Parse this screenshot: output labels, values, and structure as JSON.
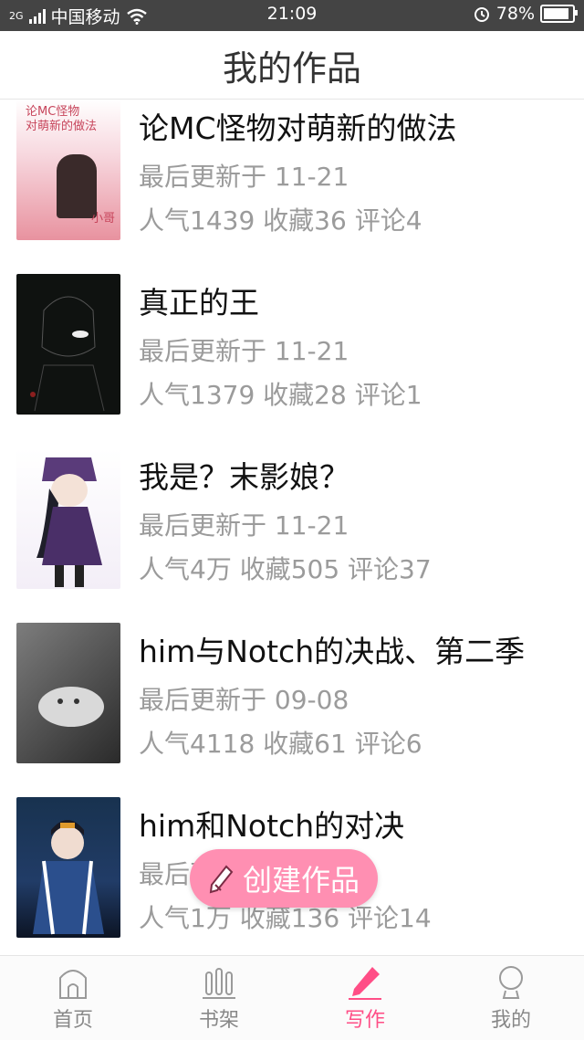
{
  "status_bar": {
    "network_small": "2G",
    "carrier": "中国移动",
    "time": "21:09",
    "battery": "78%"
  },
  "header": {
    "title": "我的作品"
  },
  "works": [
    {
      "title": "论MC怪物对萌新的做法",
      "updated": "最后更新于 11-21",
      "stats": "人气1439 收藏36 评论4",
      "cover_text_1": "论MC怪物",
      "cover_text_2": "对萌新的做法",
      "cover_text_3": "小哥"
    },
    {
      "title": "真正的王",
      "updated": "最后更新于 11-21",
      "stats": "人气1379 收藏28 评论1"
    },
    {
      "title": "我是？末影娘？",
      "updated": "最后更新于 11-21",
      "stats": "人气4万 收藏505 评论37"
    },
    {
      "title": "him与Notch的决战、第二季",
      "updated": "最后更新于 09-08",
      "stats": "人气4118 收藏61 评论6"
    },
    {
      "title": "him和Notch的对决",
      "updated": "最后更新于",
      "stats": "人气1万 收藏136 评论14"
    }
  ],
  "fab": {
    "label": "创建作品",
    "color": "#ff8fb2"
  },
  "bottom_nav": [
    {
      "label": "首页",
      "icon": "home-icon",
      "active": false
    },
    {
      "label": "书架",
      "icon": "bookshelf-icon",
      "active": false
    },
    {
      "label": "写作",
      "icon": "pencil-icon",
      "active": true
    },
    {
      "label": "我的",
      "icon": "profile-icon",
      "active": false
    }
  ],
  "colors": {
    "accent": "#ff4e86",
    "status_bar": "#444444"
  }
}
